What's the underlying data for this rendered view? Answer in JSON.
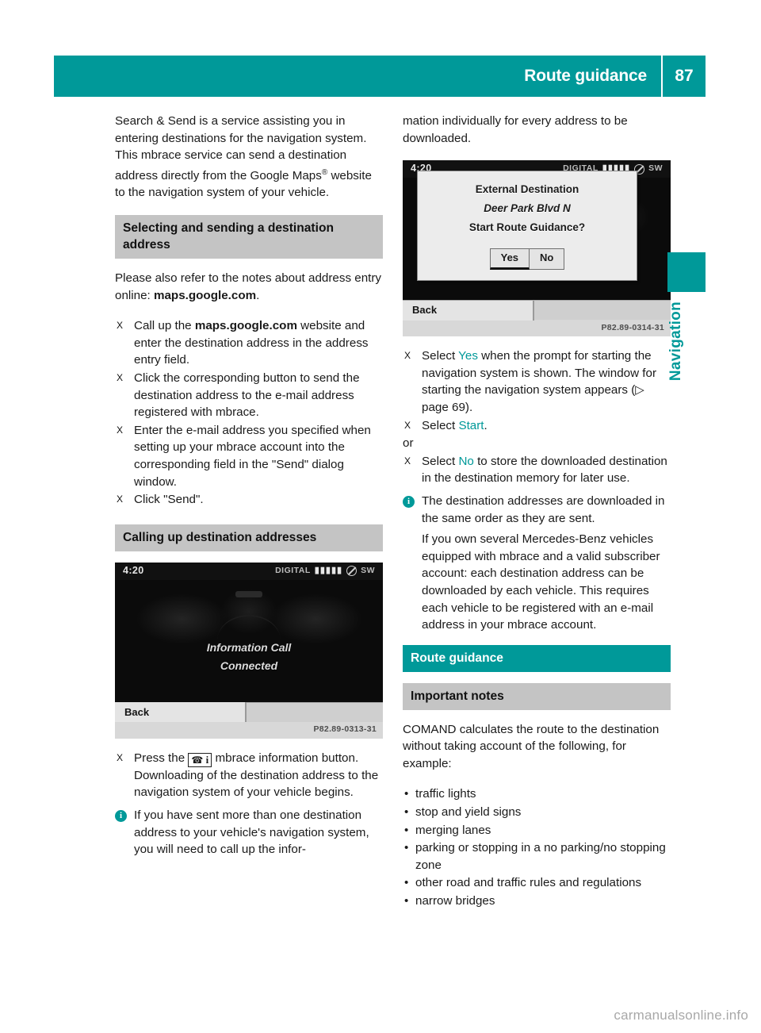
{
  "header": {
    "title": "Route guidance",
    "page_number": "87"
  },
  "side_tab": {
    "label": "Navigation",
    "accent_color": "#009999"
  },
  "watermark": "carmanualsonline.info",
  "left_column": {
    "intro_paragraph": "Search & Send is a service assisting you in entering destinations for the navigation system. This mbrace service can send a destination address directly from the Google Maps",
    "intro_sup": "®",
    "intro_paragraph_cont": " website to the navigation system of your vehicle.",
    "heading_1": "Selecting and sending a destination address",
    "notes_lead": "Please also refer to the notes about address entry online: ",
    "notes_lead_bold": "maps.google.com",
    "notes_lead_end": ".",
    "steps": [
      {
        "marker": "X",
        "pre": "Call up the ",
        "bold": "maps.google.com",
        "post": " website and enter the destination address in the address entry field."
      },
      {
        "marker": "X",
        "pre": "Click the corresponding button to send the destination address to the e-mail address registered with mbrace.",
        "bold": "",
        "post": ""
      },
      {
        "marker": "X",
        "pre": "Enter the e-mail address you specified when setting up your mbrace account into the corresponding field in the \"Send\" dialog window.",
        "bold": "",
        "post": ""
      },
      {
        "marker": "X",
        "pre": "Click \"Send\".",
        "bold": "",
        "post": ""
      }
    ],
    "heading_2": "Calling up destination addresses",
    "screenshot": {
      "clock": "4:20",
      "status_digital": "DIGITAL",
      "status_bars": "▮▮▮▮▮",
      "status_band": "SW",
      "line_1": "Information Call",
      "line_2": "Connected",
      "back_label": "Back",
      "caption": "P82.89-0313-31"
    },
    "step_press": {
      "marker": "X",
      "pre": "Press the ",
      "button_icon": "phone-info-button",
      "post": " mbrace information button. Downloading of the destination address to the navigation system of your vehicle begins."
    },
    "note": "If you have sent more than one destination address to your vehicle's navigation system, you will need to call up the infor-"
  },
  "right_column": {
    "continued_paragraph": "mation individually for every address to be downloaded.",
    "screenshot": {
      "clock": "4:20",
      "status_digital": "DIGITAL",
      "status_bars": "▮▮▮▮▮",
      "status_band": "SW",
      "dialog_title": "External Destination",
      "dialog_address": "Deer Park Blvd N",
      "dialog_question": "Start Route Guidance?",
      "button_yes": "Yes",
      "button_no": "No",
      "back_label": "Back",
      "caption": "P82.89-0314-31"
    },
    "steps": [
      {
        "marker": "X",
        "pre": "Select ",
        "ui": "Yes",
        "post": " when the prompt for starting the navigation system is shown. The window for starting the navigation system appears (▷ page 69)."
      },
      {
        "marker": "X",
        "pre": "Select ",
        "ui": "Start",
        "post": "."
      }
    ],
    "or_label": "or",
    "step_no": {
      "marker": "X",
      "pre": "Select ",
      "ui": "No",
      "post": " to store the downloaded destination in the destination memory for later use."
    },
    "note_1": "The destination addresses are downloaded in the same order as they are sent.",
    "note_2": "If you own several Mercedes-Benz vehicles equipped with mbrace and a valid subscriber account: each destination address can be downloaded by each vehicle. This requires each vehicle to be registered with an e-mail address in your mbrace account.",
    "heading_teal": "Route guidance",
    "heading_gray": "Important notes",
    "comand_paragraph": "COMAND calculates the route to the destination without taking account of the following, for example:",
    "bullets": [
      "traffic lights",
      "stop and yield signs",
      "merging lanes",
      "parking or stopping in a no parking/no stopping zone",
      "other road and traffic rules and regulations",
      "narrow bridges"
    ]
  }
}
